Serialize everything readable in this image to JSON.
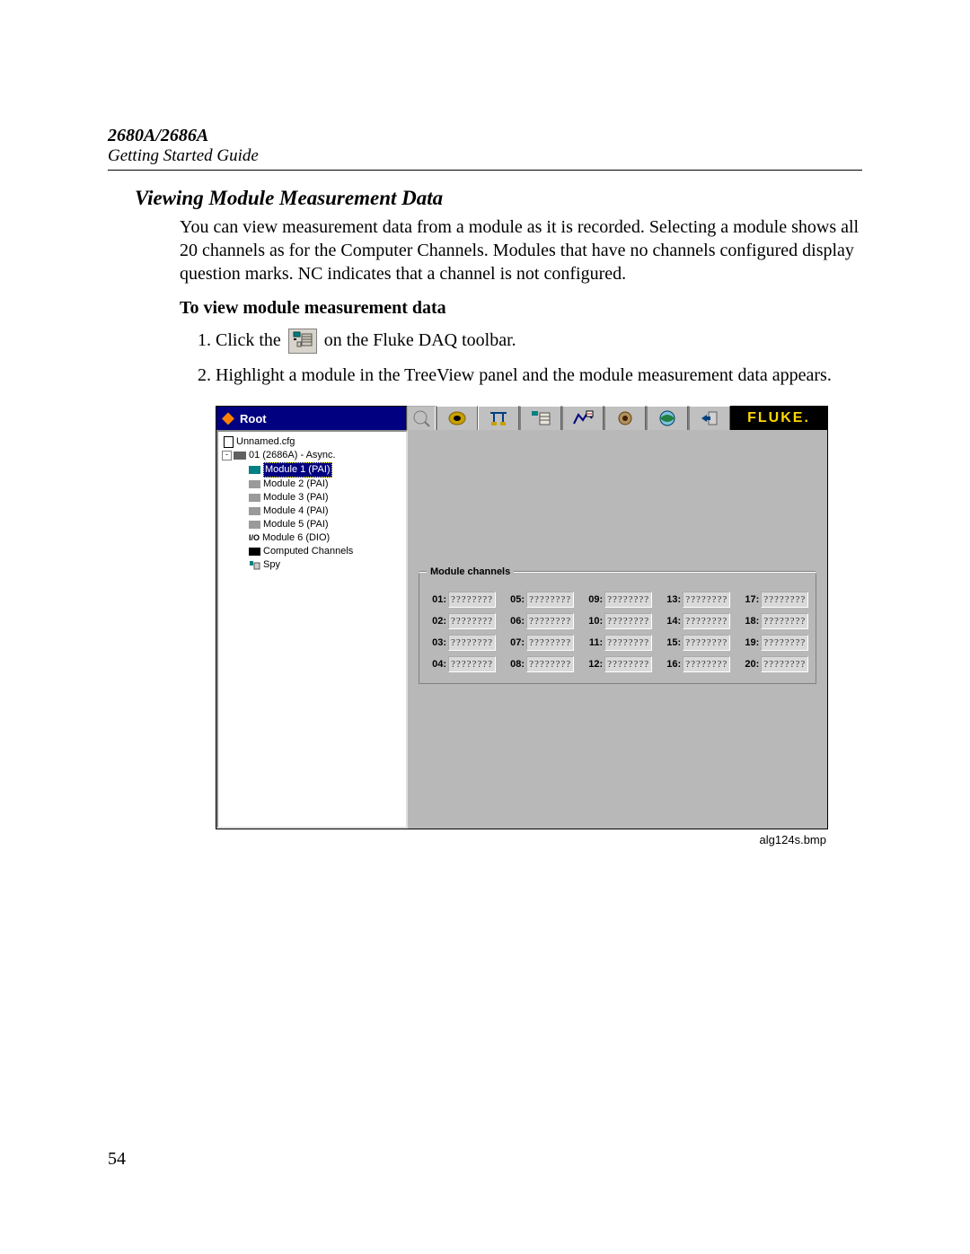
{
  "header": {
    "model": "2680A/2686A",
    "guide": "Getting Started Guide"
  },
  "section_title": "Viewing Module Measurement Data",
  "intro": "You can view measurement data from a module as it is recorded. Selecting a module shows all 20 channels as for the Computer Channels. Modules that have no channels configured display question marks. NC indicates that a channel is not configured.",
  "sub_title": "To view module measurement data",
  "steps": {
    "s1_a": "Click the ",
    "s1_b": " on the Fluke DAQ toolbar.",
    "s2": "Highlight a module in the TreeView panel and the module measurement data appears."
  },
  "page_number": "54",
  "figure_caption": "alg124s.bmp",
  "screenshot": {
    "title": "Root",
    "brand": "FLUKE.",
    "tree": {
      "root": "Unnamed.cfg",
      "device": "01 (2686A) - Async.",
      "modules": [
        {
          "label": "Module 1 (PAI)",
          "selected": true,
          "icon": "mod"
        },
        {
          "label": "Module 2 (PAI)",
          "selected": false,
          "icon": "modg"
        },
        {
          "label": "Module 3 (PAI)",
          "selected": false,
          "icon": "modg"
        },
        {
          "label": "Module 4 (PAI)",
          "selected": false,
          "icon": "modg"
        },
        {
          "label": "Module 5 (PAI)",
          "selected": false,
          "icon": "modg"
        },
        {
          "label": "Module 6 (DIO)",
          "selected": false,
          "icon": "io"
        },
        {
          "label": "Computed Channels",
          "selected": false,
          "icon": "cc"
        },
        {
          "label": "Spy",
          "selected": false,
          "icon": "spy"
        }
      ]
    },
    "groupbox_title": "Module channels",
    "channels": [
      {
        "n": "01",
        "v": "????????"
      },
      {
        "n": "05",
        "v": "????????"
      },
      {
        "n": "09",
        "v": "????????"
      },
      {
        "n": "13",
        "v": "????????"
      },
      {
        "n": "17",
        "v": "????????"
      },
      {
        "n": "02",
        "v": "????????"
      },
      {
        "n": "06",
        "v": "????????"
      },
      {
        "n": "10",
        "v": "????????"
      },
      {
        "n": "14",
        "v": "????????"
      },
      {
        "n": "18",
        "v": "????????"
      },
      {
        "n": "03",
        "v": "????????"
      },
      {
        "n": "07",
        "v": "????????"
      },
      {
        "n": "11",
        "v": "????????"
      },
      {
        "n": "15",
        "v": "????????"
      },
      {
        "n": "19",
        "v": "????????"
      },
      {
        "n": "04",
        "v": "????????"
      },
      {
        "n": "08",
        "v": "????????"
      },
      {
        "n": "12",
        "v": "????????"
      },
      {
        "n": "16",
        "v": "????????"
      },
      {
        "n": "20",
        "v": "????????"
      }
    ]
  }
}
